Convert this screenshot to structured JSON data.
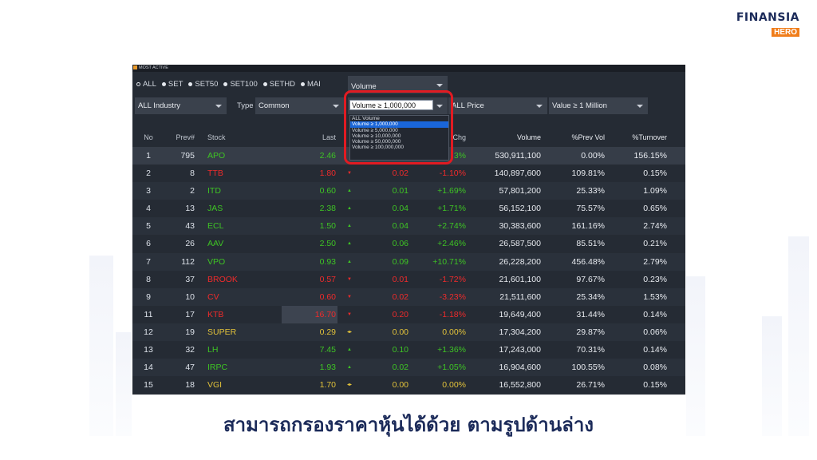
{
  "logo": {
    "main": "FINANSIA",
    "sub": "HERO"
  },
  "panel_title": "MOST ACTIVE",
  "markets": [
    {
      "label": "ALL",
      "selected": true
    },
    {
      "label": "SET",
      "selected": false
    },
    {
      "label": "SET50",
      "selected": false
    },
    {
      "label": "SET100",
      "selected": false
    },
    {
      "label": "SETHD",
      "selected": false
    },
    {
      "label": "MAI",
      "selected": false
    }
  ],
  "filters": {
    "volume_select": "Volume",
    "industry": "ALL Industry",
    "type_label": "Type",
    "type_value": "Common",
    "volume_input": "Volume ≥ 1,000,000",
    "price": "ALL Price",
    "value": "Value ≥ 1 Million"
  },
  "volume_options": [
    "ALL Volume",
    "Volume ≥ 1,000,000",
    "Volume ≥ 5,000,000",
    "Volume ≥ 10,000,000",
    "Volume ≥ 50,000,000",
    "Volume ≥ 100,000,000"
  ],
  "volume_selected_index": 1,
  "columns": {
    "no": "No",
    "prev": "Prev#",
    "stock": "Stock",
    "last": "Last",
    "pchg": "Chg",
    "volume": "Volume",
    "prev_vol": "%Prev Vol",
    "turnover": "%Turnover"
  },
  "rows": [
    {
      "no": "1",
      "prev": "795",
      "stock": "APO",
      "last": "2.46",
      "chg": "",
      "pchg": "3%",
      "volume": "530,911,100",
      "prev_vol": "0.00%",
      "turnover": "156.15%",
      "dir": "up",
      "arrow": ""
    },
    {
      "no": "2",
      "prev": "8",
      "stock": "TTB",
      "last": "1.80",
      "chg": "0.02",
      "pchg": "-1.10%",
      "volume": "140,897,600",
      "prev_vol": "109.81%",
      "turnover": "0.15%",
      "dir": "down",
      "arrow": "▼"
    },
    {
      "no": "3",
      "prev": "2",
      "stock": "ITD",
      "last": "0.60",
      "chg": "0.01",
      "pchg": "+1.69%",
      "volume": "57,801,200",
      "prev_vol": "25.33%",
      "turnover": "1.09%",
      "dir": "up",
      "arrow": "▲"
    },
    {
      "no": "4",
      "prev": "13",
      "stock": "JAS",
      "last": "2.38",
      "chg": "0.04",
      "pchg": "+1.71%",
      "volume": "56,152,100",
      "prev_vol": "75.57%",
      "turnover": "0.65%",
      "dir": "up",
      "arrow": "▲"
    },
    {
      "no": "5",
      "prev": "43",
      "stock": "ECL",
      "last": "1.50",
      "chg": "0.04",
      "pchg": "+2.74%",
      "volume": "30,383,600",
      "prev_vol": "161.16%",
      "turnover": "2.74%",
      "dir": "up",
      "arrow": "▲"
    },
    {
      "no": "6",
      "prev": "26",
      "stock": "AAV",
      "last": "2.50",
      "chg": "0.06",
      "pchg": "+2.46%",
      "volume": "26,587,500",
      "prev_vol": "85.51%",
      "turnover": "0.21%",
      "dir": "up",
      "arrow": "▲"
    },
    {
      "no": "7",
      "prev": "112",
      "stock": "VPO",
      "last": "0.93",
      "chg": "0.09",
      "pchg": "+10.71%",
      "volume": "26,228,200",
      "prev_vol": "456.48%",
      "turnover": "2.79%",
      "dir": "up",
      "arrow": "▲"
    },
    {
      "no": "8",
      "prev": "37",
      "stock": "BROOK",
      "last": "0.57",
      "chg": "0.01",
      "pchg": "-1.72%",
      "volume": "21,601,100",
      "prev_vol": "97.67%",
      "turnover": "0.23%",
      "dir": "down",
      "arrow": "▼"
    },
    {
      "no": "9",
      "prev": "10",
      "stock": "CV",
      "last": "0.60",
      "chg": "0.02",
      "pchg": "-3.23%",
      "volume": "21,511,600",
      "prev_vol": "25.34%",
      "turnover": "1.53%",
      "dir": "down",
      "arrow": "▼"
    },
    {
      "no": "11",
      "prev": "17",
      "stock": "KTB",
      "last": "16.70",
      "chg": "0.20",
      "pchg": "-1.18%",
      "volume": "19,649,400",
      "prev_vol": "31.44%",
      "turnover": "0.14%",
      "dir": "down",
      "arrow": "▼"
    },
    {
      "no": "12",
      "prev": "19",
      "stock": "SUPER",
      "last": "0.29",
      "chg": "0.00",
      "pchg": "0.00%",
      "volume": "17,304,200",
      "prev_vol": "29.87%",
      "turnover": "0.06%",
      "dir": "flat",
      "arrow": "◂▸"
    },
    {
      "no": "13",
      "prev": "32",
      "stock": "LH",
      "last": "7.45",
      "chg": "0.10",
      "pchg": "+1.36%",
      "volume": "17,243,000",
      "prev_vol": "70.31%",
      "turnover": "0.14%",
      "dir": "up",
      "arrow": "▲"
    },
    {
      "no": "14",
      "prev": "47",
      "stock": "IRPC",
      "last": "1.93",
      "chg": "0.02",
      "pchg": "+1.05%",
      "volume": "16,904,600",
      "prev_vol": "100.55%",
      "turnover": "0.08%",
      "dir": "up",
      "arrow": "▲"
    },
    {
      "no": "15",
      "prev": "18",
      "stock": "VGI",
      "last": "1.70",
      "chg": "0.00",
      "pchg": "0.00%",
      "volume": "16,552,800",
      "prev_vol": "26.71%",
      "turnover": "0.15%",
      "dir": "flat",
      "arrow": "◂▸"
    }
  ],
  "caption": "สามารถกรองราคาหุ้นได้ด้วย ตามรูปด้านล่าง",
  "colors": {
    "up": "#3ec424",
    "down": "#ef2b2b",
    "flat": "#e2c23a",
    "highlight": "#e11b22",
    "brand": "#1c2b5a"
  }
}
